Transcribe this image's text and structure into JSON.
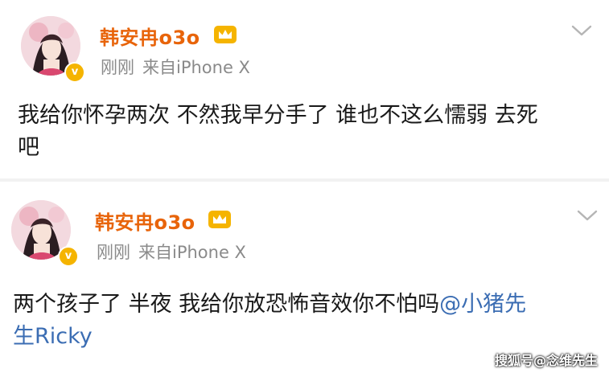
{
  "posts": [
    {
      "username": "韩安冉o3o",
      "time": "刚刚",
      "source": "来自iPhone X",
      "body_line1": "我给你怀孕两次 不然我早分手了 谁也不这么懦弱 去死",
      "body_line2": "吧"
    },
    {
      "username": "韩安冉o3o",
      "time": "刚刚",
      "source": "来自iPhone X",
      "body_text": "两个孩子了 半夜 我给你放恐怖音效你不怕吗",
      "mention_line1": "@小猪先",
      "mention_line2": "生Ricky"
    }
  ],
  "verified_badge": "v",
  "watermark": "搜狐号@念维先生",
  "colors": {
    "username": "#e8640a",
    "mention": "#3b6db3",
    "meta": "#8a8a8a",
    "badge": "#f5b400"
  },
  "icons": [
    "avatar",
    "verified-badge-icon",
    "crown-vip-icon",
    "chevron-down-icon"
  ]
}
